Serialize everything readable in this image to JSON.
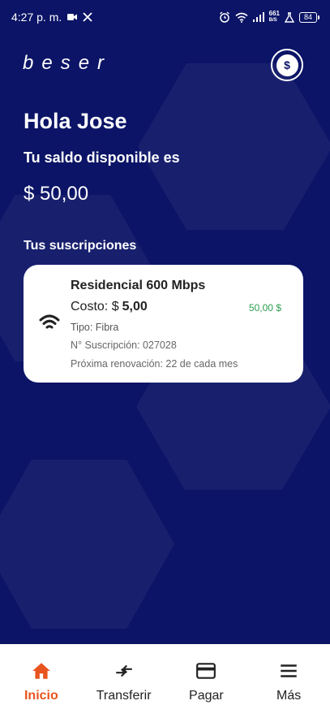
{
  "status_bar": {
    "time": "4:27 p. m.",
    "network_speed": "661",
    "network_unit": "B/S",
    "battery": "84"
  },
  "header": {
    "logo_text": "beser",
    "balance_button_symbol": "$"
  },
  "greeting": "Hola Jose",
  "balance": {
    "label": "Tu saldo disponible es",
    "amount": "$ 50,00"
  },
  "subscriptions": {
    "title": "Tus suscripciones",
    "items": [
      {
        "plan": "Residencial 600 Mbps",
        "cost_label": "Costo: $",
        "cost_value": "5,00",
        "balance": "50,00  $",
        "type": "Tipo: Fibra",
        "number": "N° Suscripción: 027028",
        "renewal": "Próxima renovación: 22 de cada mes",
        "icon": "wifi-icon"
      }
    ]
  },
  "bottom_nav": {
    "items": [
      {
        "label": "Inicio",
        "icon": "home-icon",
        "active": true
      },
      {
        "label": "Transferir",
        "icon": "transfer-icon",
        "active": false
      },
      {
        "label": "Pagar",
        "icon": "card-icon",
        "active": false
      },
      {
        "label": "Más",
        "icon": "menu-icon",
        "active": false
      }
    ]
  },
  "colors": {
    "background": "#0b1466",
    "accent": "#e8541e",
    "positive": "#2e9e4f",
    "card": "#ffffff"
  }
}
